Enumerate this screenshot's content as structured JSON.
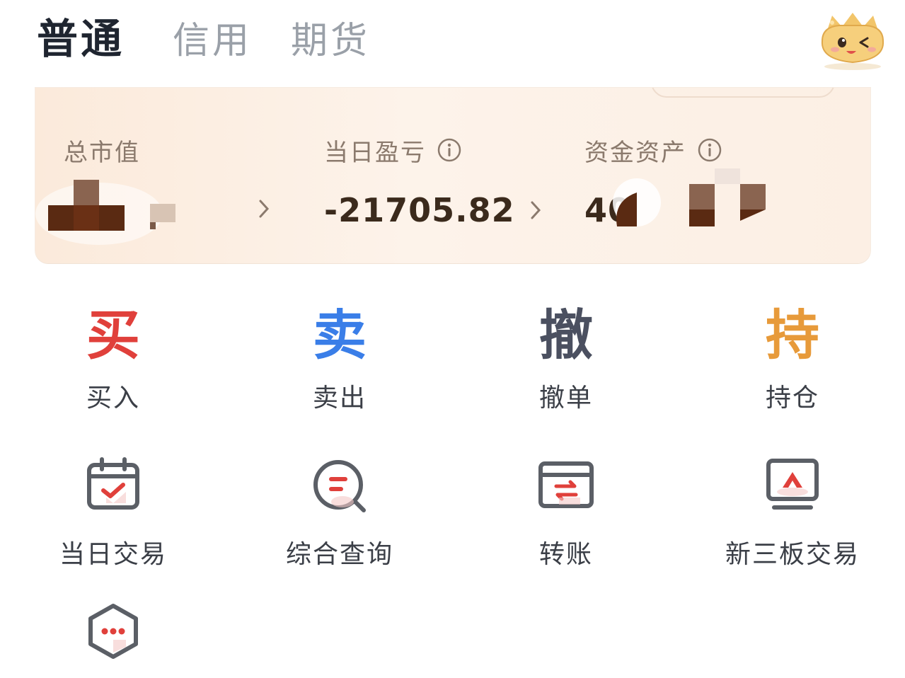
{
  "tabs": [
    {
      "label": "普通",
      "active": true
    },
    {
      "label": "信用",
      "active": false
    },
    {
      "label": "期货",
      "active": false
    }
  ],
  "assets": {
    "total_market_value": {
      "label": "总市值",
      "value": ""
    },
    "daily_pnl": {
      "label": "当日盈亏",
      "value": "-21705.82"
    },
    "fund_assets": {
      "label": "资金资产",
      "value": "40"
    }
  },
  "quick_actions": [
    {
      "char": "买",
      "label": "买入",
      "color": "#e0403b"
    },
    {
      "char": "卖",
      "label": "卖出",
      "color": "#3a7ee8"
    },
    {
      "char": "撤",
      "label": "撤单",
      "color": "#4b5060"
    },
    {
      "char": "持",
      "label": "持仓",
      "color": "#e79a3a"
    }
  ],
  "tools": [
    {
      "label": "当日交易",
      "icon": "calendar-check-icon"
    },
    {
      "label": "综合查询",
      "icon": "search-list-icon"
    },
    {
      "label": "转账",
      "icon": "transfer-card-icon"
    },
    {
      "label": "新三板交易",
      "icon": "monitor-triangle-icon"
    },
    {
      "label": "",
      "icon": "more-hexagon-icon"
    }
  ],
  "colors": {
    "accent_red": "#e0403b",
    "icon_gray": "#5b5f66",
    "value_brown": "#3b2a1c"
  }
}
